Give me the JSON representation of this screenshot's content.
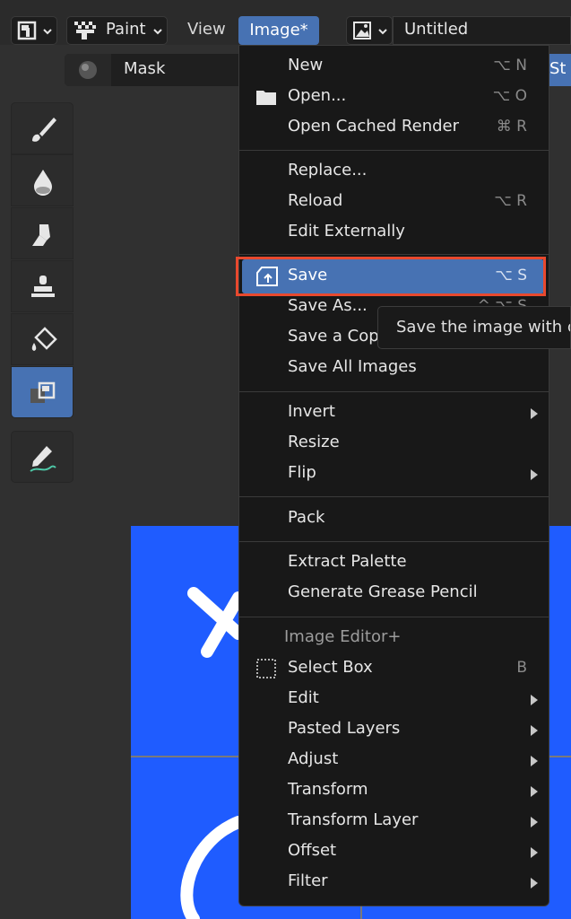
{
  "header": {
    "paint_mode": "Paint",
    "menus": [
      "View",
      "Image*"
    ],
    "image_name": "Untitled",
    "mask_label": "Mask",
    "right_cut_label": "St"
  },
  "menu": {
    "items": [
      {
        "label": "New",
        "shortcut": "⌥ N"
      },
      {
        "label": "Open...",
        "shortcut": "⌥ O"
      },
      {
        "label": "Open Cached Render",
        "shortcut": "⌘ R"
      },
      {
        "label": "Replace..."
      },
      {
        "label": "Reload",
        "shortcut": "⌥ R"
      },
      {
        "label": "Edit Externally"
      },
      {
        "label": "Save",
        "shortcut": "⌥ S"
      },
      {
        "label": "Save As...",
        "shortcut": "^ ⌥ S"
      },
      {
        "label": "Save a Copy"
      },
      {
        "label": "Save All Images"
      },
      {
        "label": "Invert"
      },
      {
        "label": "Resize"
      },
      {
        "label": "Flip"
      },
      {
        "label": "Pack"
      },
      {
        "label": "Extract Palette"
      },
      {
        "label": "Generate Grease Pencil"
      },
      {
        "label": "Select Box",
        "shortcut": "B"
      },
      {
        "label": "Edit"
      },
      {
        "label": "Pasted Layers"
      },
      {
        "label": "Adjust"
      },
      {
        "label": "Transform"
      },
      {
        "label": "Transform Layer"
      },
      {
        "label": "Offset"
      },
      {
        "label": "Filter"
      }
    ],
    "section_header": "Image Editor+"
  },
  "tooltip": {
    "text": "Save the image with c"
  },
  "tools": [
    "brush-icon",
    "blur-icon",
    "smear-icon",
    "clone-icon",
    "fill-icon",
    "mask-icon",
    "annotate-icon"
  ],
  "colors": {
    "accent": "#4772b3",
    "canvas": "#1f5cff",
    "highlight_box": "#e8492e"
  }
}
